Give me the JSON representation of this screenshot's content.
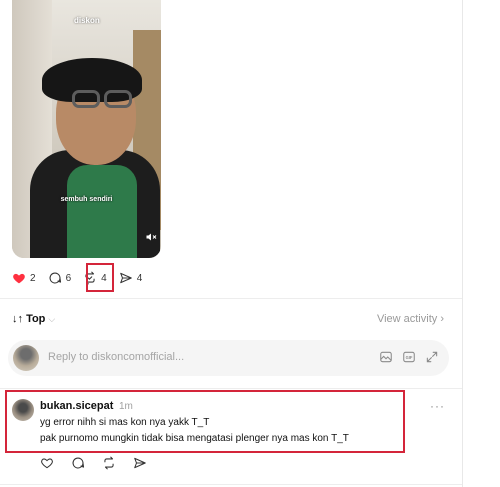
{
  "video": {
    "brand": "diskon",
    "caption": "sembuh sendiri",
    "mute_icon": "speaker-mute-icon"
  },
  "post_actions": {
    "likes": "2",
    "comments": "6",
    "reposts": "4",
    "shares": "4",
    "like_color": "#ff3040",
    "highlight_color": "#d4253a"
  },
  "sort": {
    "label": "Top",
    "view_activity": "View activity"
  },
  "reply": {
    "placeholder": "Reply to diskoncomofficial..."
  },
  "comment": {
    "username": "bukan.sicepat",
    "time": "1m",
    "line1": "yg error nihh si mas kon nya yakk T_T",
    "line2": "pak purnomo mungkin tidak bisa mengatasi plenger nya mas kon T_T",
    "more": "···"
  }
}
